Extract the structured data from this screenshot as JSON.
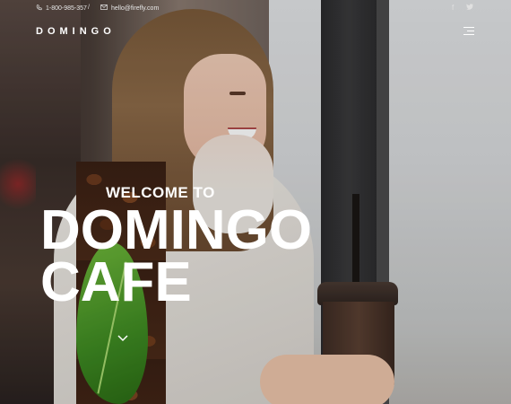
{
  "topbar": {
    "phone": "1-800-985-357",
    "separator": "/",
    "email": "hello@firefly.com",
    "phone_icon": "phone-icon",
    "email_icon": "mail-icon",
    "social": [
      "facebook-icon",
      "twitter-icon"
    ]
  },
  "header": {
    "logo": "DOMINGO",
    "menu_icon": "hamburger-menu-icon"
  },
  "hero": {
    "welcome": "WELCOME TO",
    "title_line1": "DOMINGO",
    "title_line2": "CAFE",
    "scroll_icon": "chevron-down-icon"
  },
  "colors": {
    "text": "#ffffff",
    "leaf_green": "#4e9a2a",
    "coffee_brown": "#4a2a18"
  }
}
